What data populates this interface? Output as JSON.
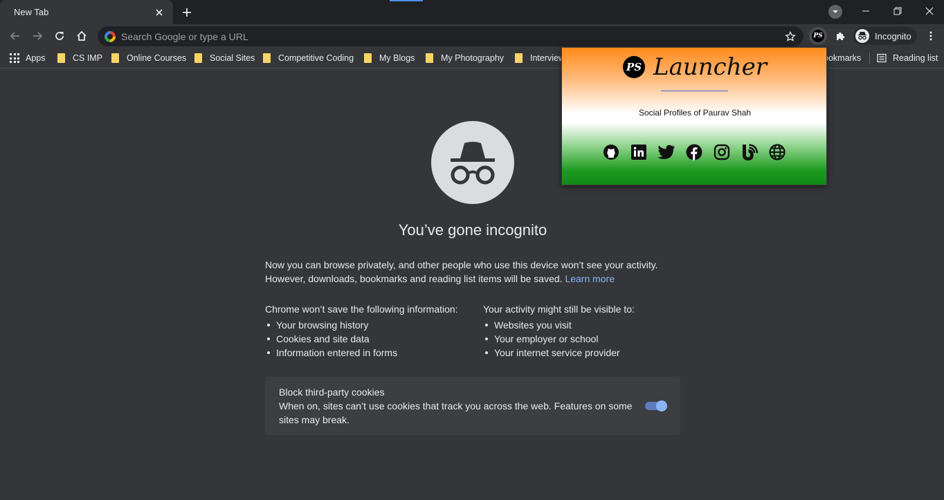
{
  "tab": {
    "title": "New Tab"
  },
  "omnibox": {
    "placeholder": "Search Google or type a URL"
  },
  "profile": {
    "label": "Incognito"
  },
  "bookmarks": {
    "apps": "Apps",
    "items": [
      "CS IMP",
      "Online Courses",
      "Social Sites",
      "Competitive Coding",
      "My Blogs",
      "My Photography",
      "Interview"
    ],
    "other": "ookmarks",
    "reading_list": "Reading list"
  },
  "incognito": {
    "title": "You’ve gone incognito",
    "intro": "Now you can browse privately, and other people who use this device won’t see your activity. However, downloads, bookmarks and reading list items will be saved.",
    "learn_more": "Learn more",
    "wont_save_heading": "Chrome won’t save the following information:",
    "wont_save": [
      "Your browsing history",
      "Cookies and site data",
      "Information entered in forms"
    ],
    "visible_heading": "Your activity might still be visible to:",
    "visible": [
      "Websites you visit",
      "Your employer or school",
      "Your internet service provider"
    ],
    "cookies": {
      "title": "Block third-party cookies",
      "description": "When on, sites can’t use cookies that track you across the web. Features on some sites may break.",
      "enabled": true
    }
  },
  "popup": {
    "logo": "PS",
    "title": "Launcher",
    "subtitle": "Social Profiles of Paurav Shah",
    "icons": [
      "github-icon",
      "linkedin-icon",
      "twitter-icon",
      "facebook-icon",
      "instagram-icon",
      "blog-icon",
      "globe-icon"
    ]
  },
  "colors": {
    "link": "#8ab4f8",
    "toggle": "#8ab4f8",
    "background": "#35363a",
    "tabstrip": "#202124"
  }
}
